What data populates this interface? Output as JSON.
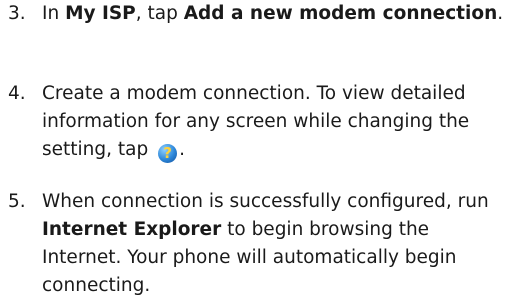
{
  "steps": [
    {
      "number": "3.",
      "parts": [
        "In ",
        "My ISP",
        ", tap ",
        "Add a new modem connection",
        "."
      ]
    },
    {
      "number": "4.",
      "parts": [
        "Create a modem connection. To view detailed information for any screen while changing the setting, tap ",
        "."
      ],
      "icon": "help-icon"
    },
    {
      "number": "5.",
      "parts": [
        "When connection is successfully configured, run ",
        "Internet Explorer",
        " to begin browsing the Internet. Your phone will automatically begin connecting."
      ]
    }
  ],
  "icon_glyph": "?"
}
